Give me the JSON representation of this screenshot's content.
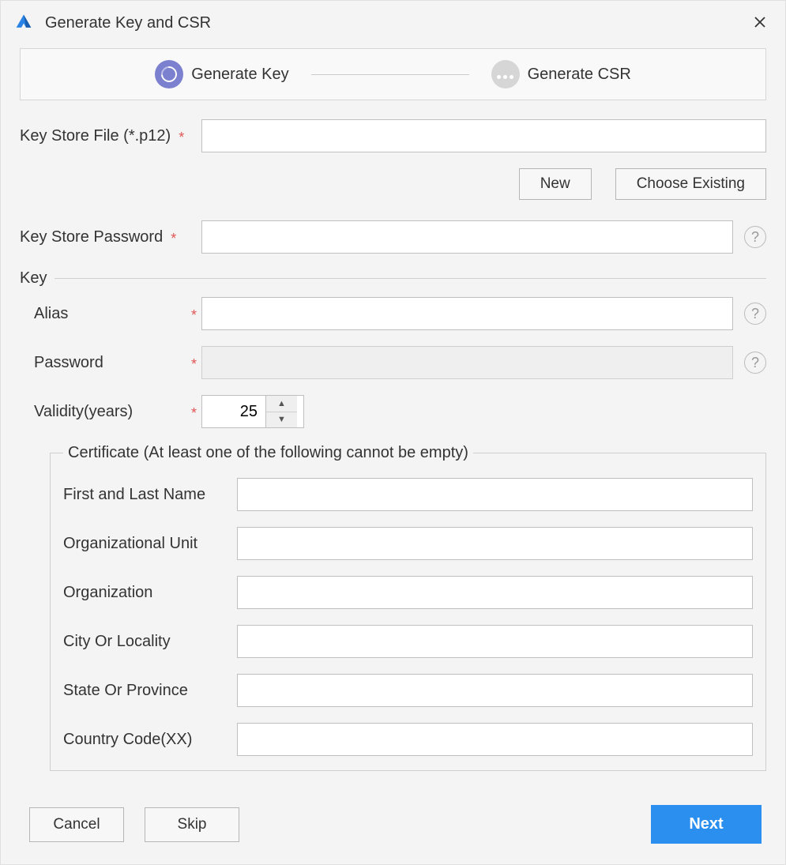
{
  "window": {
    "title": "Generate Key and CSR"
  },
  "stepper": {
    "step1": "Generate Key",
    "step2": "Generate CSR"
  },
  "form": {
    "keyStoreFileLabel": "Key Store File (*.p12)",
    "keyStoreFileValue": "",
    "newButton": "New",
    "chooseExistingButton": "Choose Existing",
    "keyStorePasswordLabel": "Key Store Password",
    "keyStorePasswordValue": ""
  },
  "keyGroup": {
    "legend": "Key",
    "aliasLabel": "Alias",
    "aliasValue": "",
    "passwordLabel": "Password",
    "passwordValue": "",
    "validityLabel": "Validity(years)",
    "validityValue": "25"
  },
  "certGroup": {
    "legend": "Certificate (At least one of the following cannot be empty)",
    "firstLastNameLabel": "First and Last Name",
    "firstLastNameValue": "",
    "orgUnitLabel": "Organizational Unit",
    "orgUnitValue": "",
    "orgLabel": "Organization",
    "orgValue": "",
    "cityLabel": "City Or Locality",
    "cityValue": "",
    "stateLabel": "State Or Province",
    "stateValue": "",
    "countryLabel": "Country Code(XX)",
    "countryValue": ""
  },
  "footer": {
    "cancel": "Cancel",
    "skip": "Skip",
    "next": "Next"
  }
}
